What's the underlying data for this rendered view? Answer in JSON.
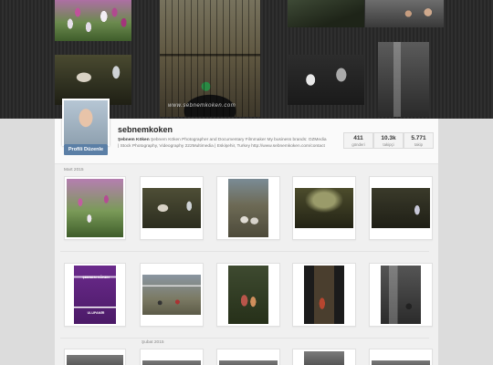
{
  "profile": {
    "username": "sebnemkoken",
    "edit_button": "Profili Düzenle",
    "bio_name": "Şebnem Köken",
    "bio_text": "Şebnem Köken Photographer and Documentary Filmmaker My business brands: OZMedia | Stock Photography, Videography 222Multimedia | Eskişehir, Turkey http://www.sebnemkoken.com/contact",
    "stats": [
      {
        "value": "411",
        "label": "gönderi"
      },
      {
        "value": "10.3k",
        "label": "takipçi"
      },
      {
        "value": "5.771",
        "label": "takip"
      }
    ]
  },
  "cover": {
    "watermark": "www.sebnemkoken.com"
  },
  "feed": {
    "sections": [
      {
        "label": "Mart 2015"
      },
      {
        "label": "Şubat 2015"
      }
    ],
    "poster": {
      "title": "ŞEBNEM KÖKEN",
      "subtitle": "ULUPAMİR"
    }
  }
}
